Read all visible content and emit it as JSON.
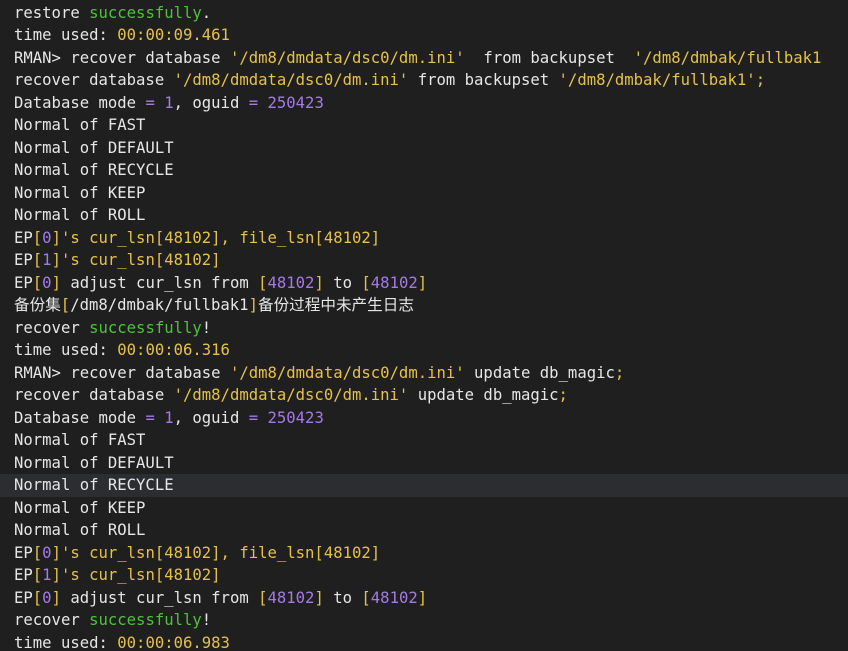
{
  "terminal": {
    "colors": {
      "background": "#1f1f1f",
      "text": "#e6e6e6",
      "green": "#4ec23a",
      "yellow": "#e6c14a",
      "purple": "#a57ae6",
      "highlight": "#2b2d30"
    },
    "highlighted_line": 21,
    "lines": [
      [
        [
          "restore ",
          "default"
        ],
        [
          "successfully",
          "green"
        ],
        [
          ".",
          "default"
        ]
      ],
      [
        [
          "time used: ",
          "default"
        ],
        [
          "00:00:09.461",
          "yellow"
        ]
      ],
      [
        [
          "RMAN> recover database ",
          "default"
        ],
        [
          "'/dm8/dmdata/dsc0/dm.ini'",
          "str"
        ],
        [
          "  from backupset  ",
          "default"
        ],
        [
          "'/dm8/dmbak/fullbak1",
          "str"
        ]
      ],
      [
        [
          "recover database ",
          "default"
        ],
        [
          "'/dm8/dmdata/dsc0/dm.ini'",
          "str"
        ],
        [
          " from backupset ",
          "default"
        ],
        [
          "'/dm8/dmbak/fullbak1'",
          "str"
        ],
        [
          ";",
          "yellow"
        ]
      ],
      [
        [
          "Database mode ",
          "default"
        ],
        [
          "=",
          "purple"
        ],
        [
          " ",
          "default"
        ],
        [
          "1",
          "purple"
        ],
        [
          ", oguid ",
          "default"
        ],
        [
          "=",
          "purple"
        ],
        [
          " ",
          "default"
        ],
        [
          "250423",
          "purple"
        ]
      ],
      [
        [
          "Normal of FAST",
          "default"
        ]
      ],
      [
        [
          "Normal of DEFAULT",
          "default"
        ]
      ],
      [
        [
          "Normal of RECYCLE",
          "default"
        ]
      ],
      [
        [
          "Normal of KEEP",
          "default"
        ]
      ],
      [
        [
          "Normal of ROLL",
          "default"
        ]
      ],
      [
        [
          "EP",
          "default"
        ],
        [
          "[",
          "yellow"
        ],
        [
          "0",
          "purple"
        ],
        [
          "]",
          "yellow"
        ],
        [
          "'s cur_lsn[48102], file_lsn[48102]",
          "yellow"
        ]
      ],
      [
        [
          "EP",
          "default"
        ],
        [
          "[",
          "yellow"
        ],
        [
          "1",
          "purple"
        ],
        [
          "]",
          "yellow"
        ],
        [
          "'s cur_lsn[48102]",
          "yellow"
        ]
      ],
      [
        [
          "EP",
          "default"
        ],
        [
          "[",
          "yellow"
        ],
        [
          "0",
          "purple"
        ],
        [
          "]",
          "yellow"
        ],
        [
          " adjust cur_lsn from ",
          "default"
        ],
        [
          "[",
          "yellow"
        ],
        [
          "48102",
          "purple"
        ],
        [
          "]",
          "yellow"
        ],
        [
          " to ",
          "default"
        ],
        [
          "[",
          "yellow"
        ],
        [
          "48102",
          "purple"
        ],
        [
          "]",
          "yellow"
        ]
      ],
      [
        [
          "备份集",
          "default"
        ],
        [
          "[",
          "yellow"
        ],
        [
          "/dm8/dmbak/fullbak1",
          "default"
        ],
        [
          "]",
          "yellow"
        ],
        [
          "备份过程中未产生日志",
          "default"
        ]
      ],
      [
        [
          "recover ",
          "default"
        ],
        [
          "successfully",
          "green"
        ],
        [
          "!",
          "default"
        ]
      ],
      [
        [
          "time used: ",
          "default"
        ],
        [
          "00:00:06.316",
          "yellow"
        ]
      ],
      [
        [
          "RMAN> recover database ",
          "default"
        ],
        [
          "'/dm8/dmdata/dsc0/dm.ini'",
          "str"
        ],
        [
          " update db_magic",
          "default"
        ],
        [
          ";",
          "yellow"
        ]
      ],
      [
        [
          "recover database ",
          "default"
        ],
        [
          "'/dm8/dmdata/dsc0/dm.ini'",
          "str"
        ],
        [
          " update db_magic",
          "default"
        ],
        [
          ";",
          "yellow"
        ]
      ],
      [
        [
          "Database mode ",
          "default"
        ],
        [
          "=",
          "purple"
        ],
        [
          " ",
          "default"
        ],
        [
          "1",
          "purple"
        ],
        [
          ", oguid ",
          "default"
        ],
        [
          "=",
          "purple"
        ],
        [
          " ",
          "default"
        ],
        [
          "250423",
          "purple"
        ]
      ],
      [
        [
          "Normal of FAST",
          "default"
        ]
      ],
      [
        [
          "Normal of DEFAULT",
          "default"
        ]
      ],
      [
        [
          "Normal of RECYCLE",
          "default"
        ]
      ],
      [
        [
          "Normal of KEEP",
          "default"
        ]
      ],
      [
        [
          "Normal of ROLL",
          "default"
        ]
      ],
      [
        [
          "EP",
          "default"
        ],
        [
          "[",
          "yellow"
        ],
        [
          "0",
          "purple"
        ],
        [
          "]",
          "yellow"
        ],
        [
          "'s cur_lsn[48102], file_lsn[48102]",
          "yellow"
        ]
      ],
      [
        [
          "EP",
          "default"
        ],
        [
          "[",
          "yellow"
        ],
        [
          "1",
          "purple"
        ],
        [
          "]",
          "yellow"
        ],
        [
          "'s cur_lsn[48102]",
          "yellow"
        ]
      ],
      [
        [
          "EP",
          "default"
        ],
        [
          "[",
          "yellow"
        ],
        [
          "0",
          "purple"
        ],
        [
          "]",
          "yellow"
        ],
        [
          " adjust cur_lsn from ",
          "default"
        ],
        [
          "[",
          "yellow"
        ],
        [
          "48102",
          "purple"
        ],
        [
          "]",
          "yellow"
        ],
        [
          " to ",
          "default"
        ],
        [
          "[",
          "yellow"
        ],
        [
          "48102",
          "purple"
        ],
        [
          "]",
          "yellow"
        ]
      ],
      [
        [
          "recover ",
          "default"
        ],
        [
          "successfully",
          "green"
        ],
        [
          "!",
          "default"
        ]
      ],
      [
        [
          "time used: ",
          "default"
        ],
        [
          "00:00:06.983",
          "yellow"
        ]
      ]
    ]
  }
}
